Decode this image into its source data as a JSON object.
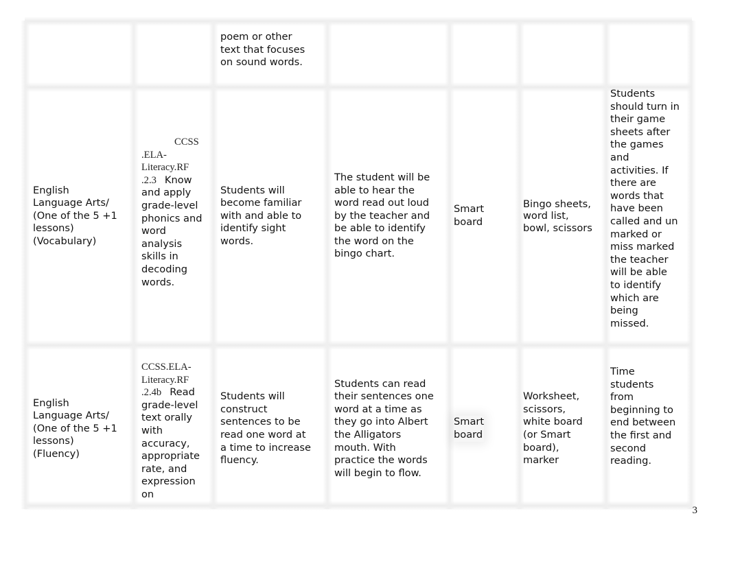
{
  "document": {
    "page_number": "3",
    "rows": [
      {
        "subject": "",
        "standard_code": "",
        "standard_text": "",
        "objective": "poem or other\ntext that focuses\non sound words.",
        "assessment": "",
        "technology": "",
        "materials": "",
        "evaluation": ""
      },
      {
        "subject": "English\nLanguage Arts/\n(One of the 5 +1\nlessons)\n(Vocabulary)",
        "standard_code_lines": [
          "CCSS",
          ".ELA-",
          "Literacy.RF",
          ".2.3"
        ],
        "standard_text": "Know\nand apply\ngrade-level\nphonics and\nword\nanalysis\nskills in\ndecoding\nwords.",
        "objective": "Students will\nbecome familiar\nwith and able to\nidentify sight\nwords.",
        "assessment": "The student will be\nable to hear the\nword read out loud\nby the teacher and\nbe able to identify\nthe word on the\nbingo chart.",
        "technology": "Smart\nboard",
        "materials": "Bingo sheets,\nword list,\nbowl, scissors",
        "evaluation": "Students\nshould turn in\ntheir game\nsheets after\nthe games\nand\nactivities. If\nthere are\nwords that\nhave been\ncalled and un\nmarked or\nmiss marked\nthe teacher\nwill be able\nto identify\nwhich are\nbeing\nmissed."
      },
      {
        "subject": "English\nLanguage Arts/\n(One of the 5 +1\nlessons)\n(Fluency)",
        "standard_code_lines": [
          "CCSS.ELA-",
          "Literacy.RF",
          ".2.4b"
        ],
        "standard_text": "Read\ngrade-level\ntext orally\nwith\naccuracy,\nappropriate\nrate, and\nexpression\non",
        "objective": "Students will\nconstruct\nsentences to be\nread one word at\na time to increase\nfluency.",
        "assessment": "Students can read\ntheir sentences one\nword at a time as\nthey go into Albert\nthe Alligators\nmouth. With\npractice the words\nwill begin to flow.",
        "technology": "Smart\nboard",
        "materials": "Worksheet,\nscissors,\nwhite board\n(or Smart\nboard),\nmarker",
        "evaluation": "Time\nstudents\nfrom\nbeginning to\nend between\nthe first and\nsecond\nreading."
      }
    ]
  }
}
